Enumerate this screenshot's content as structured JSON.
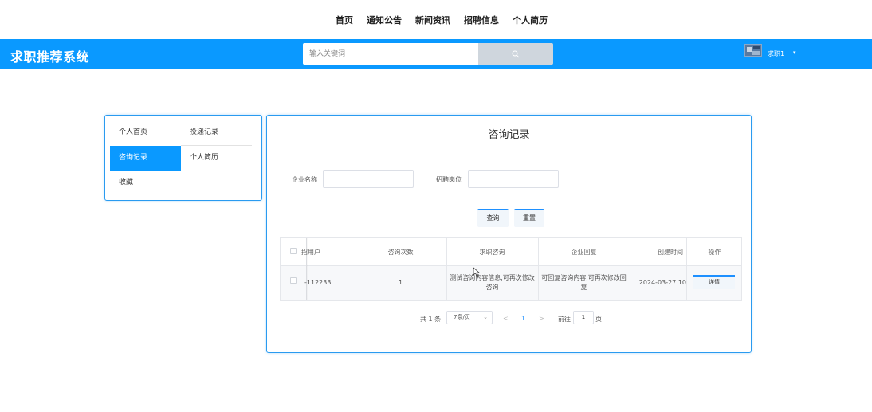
{
  "topnav": {
    "items": [
      {
        "label": "首页"
      },
      {
        "label": "通知公告"
      },
      {
        "label": "新闻资讯"
      },
      {
        "label": "招聘信息"
      },
      {
        "label": "个人简历"
      }
    ]
  },
  "header": {
    "brand": "求职推荐系统",
    "search_placeholder": "输入关键词",
    "user_name": "求职1",
    "user_caret": "▾",
    "accent_color": "#0a99ff",
    "search_icon": "search-icon"
  },
  "sidemenu": {
    "items": [
      {
        "label": "个人首页"
      },
      {
        "label": "投递记录"
      },
      {
        "label": "咨询记录",
        "active": true
      },
      {
        "label": "个人简历"
      },
      {
        "label": "收藏"
      }
    ]
  },
  "panel": {
    "title": "咨询记录",
    "filters": {
      "company_label": "企业名称",
      "position_label": "招聘岗位"
    },
    "query_label": "查询",
    "reset_label": "重置",
    "table": {
      "columns": [
        "招用户",
        "咨询次数",
        "求职咨询",
        "企业回复",
        "创建时间",
        "操作"
      ],
      "rows": [
        {
          "user": "-112233",
          "count": "1",
          "question": "测试咨询内容信息,可再次修改咨询",
          "reply": "可回复咨询内容,可再次修改回复",
          "created": "2024-03-27 10",
          "action": "详情"
        }
      ]
    },
    "pagination": {
      "total": "共 1 条",
      "page_size": "7条/页",
      "prev": "<",
      "current": "1",
      "next": ">",
      "goto": "前往",
      "goto_value": "1",
      "page_suffix": "页"
    }
  }
}
